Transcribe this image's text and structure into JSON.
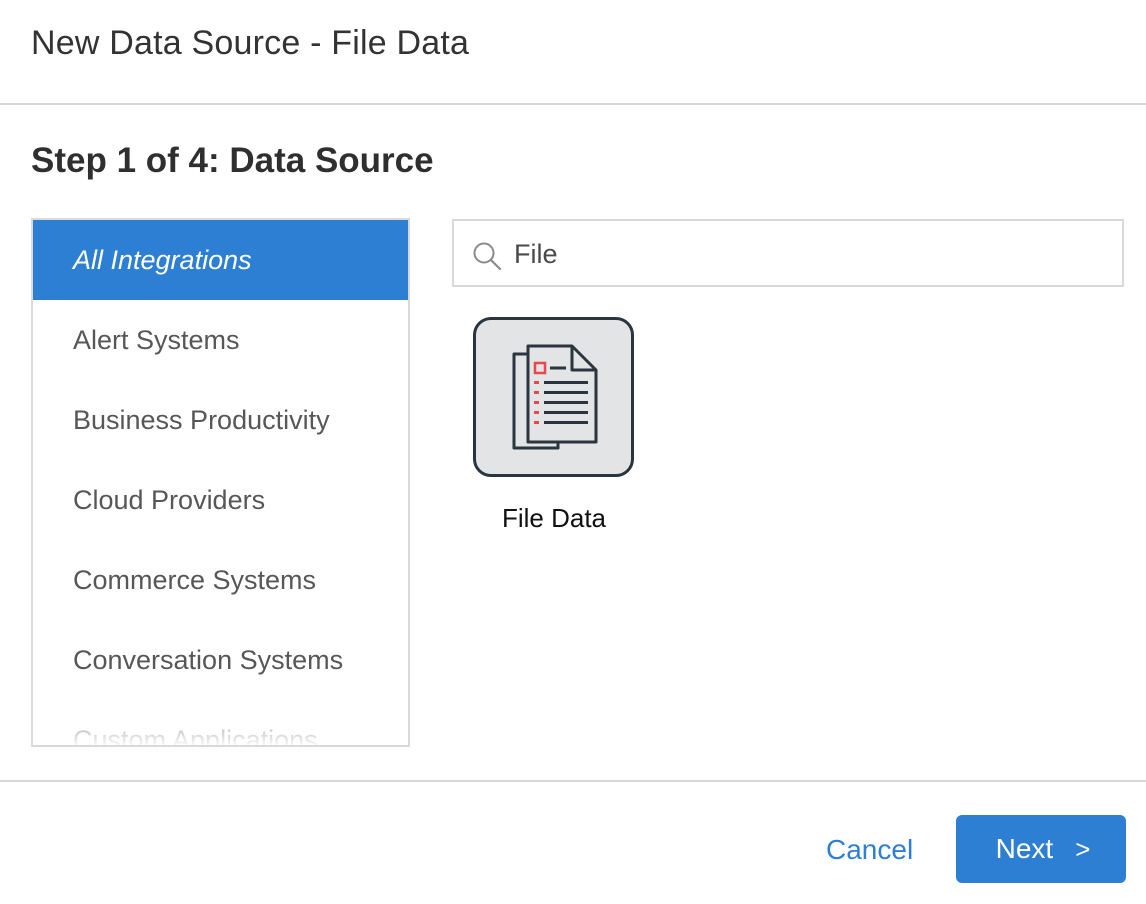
{
  "dialog": {
    "title": "New Data Source - File Data",
    "step_title": "Step 1 of 4: Data Source"
  },
  "categories": {
    "active_index": 0,
    "items": [
      {
        "label": "All Integrations"
      },
      {
        "label": "Alert Systems"
      },
      {
        "label": "Business Productivity"
      },
      {
        "label": "Cloud Providers"
      },
      {
        "label": "Commerce Systems"
      },
      {
        "label": "Conversation Systems"
      },
      {
        "label": "Custom Applications"
      }
    ]
  },
  "search": {
    "value": "File",
    "placeholder": "",
    "icon": "search-icon"
  },
  "integrations": [
    {
      "label": "File Data",
      "icon": "file-document-icon"
    }
  ],
  "footer": {
    "cancel_label": "Cancel",
    "next_label": "Next",
    "next_icon": ">"
  },
  "colors": {
    "accent": "#2d7fd4",
    "tile_border": "#2a3540",
    "tile_background": "#e3e4e5",
    "icon_highlight": "#e8474c"
  }
}
